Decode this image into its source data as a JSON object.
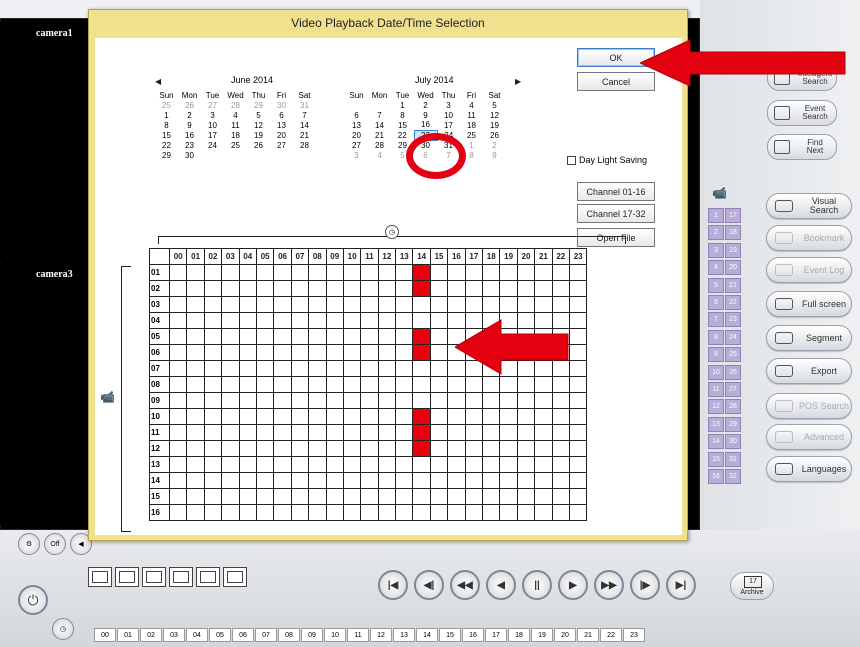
{
  "cameras": {
    "cam1": "camera1",
    "cam3": "camera3"
  },
  "dialog": {
    "title": "Video Playback Date/Time Selection",
    "ok": "OK",
    "cancel": "Cancel",
    "daylight": "Day Light Saving",
    "ch1": "Channel 01-16",
    "ch2": "Channel 17-32",
    "open": "Open File",
    "cal1": {
      "title": "June 2014",
      "days": [
        "Sun",
        "Mon",
        "Tue",
        "Wed",
        "Thu",
        "Fri",
        "Sat"
      ],
      "weeks": [
        [
          "25",
          "26",
          "27",
          "28",
          "29",
          "30",
          "31"
        ],
        [
          "1",
          "2",
          "3",
          "4",
          "5",
          "6",
          "7"
        ],
        [
          "8",
          "9",
          "10",
          "11",
          "12",
          "13",
          "14"
        ],
        [
          "15",
          "16",
          "17",
          "18",
          "19",
          "20",
          "21"
        ],
        [
          "22",
          "23",
          "24",
          "25",
          "26",
          "27",
          "28"
        ],
        [
          "29",
          "30",
          "",
          "",
          "",
          "",
          ""
        ]
      ]
    },
    "cal2": {
      "title": "July 2014",
      "days": [
        "Sun",
        "Mon",
        "Tue",
        "Wed",
        "Thu",
        "Fri",
        "Sat"
      ],
      "weeks": [
        [
          "",
          "",
          "1",
          "2",
          "3",
          "4",
          "5"
        ],
        [
          "6",
          "7",
          "8",
          "9",
          "10",
          "11",
          "12"
        ],
        [
          "13",
          "14",
          "15",
          "16",
          "17",
          "18",
          "19"
        ],
        [
          "20",
          "21",
          "22",
          "23",
          "24",
          "25",
          "26"
        ],
        [
          "27",
          "28",
          "29",
          "30",
          "31",
          "1",
          "2"
        ],
        [
          "3",
          "4",
          "5",
          "6",
          "7",
          "8",
          "9"
        ]
      ],
      "selected": "23"
    }
  },
  "grid": {
    "hours": [
      "00",
      "01",
      "02",
      "03",
      "04",
      "05",
      "06",
      "07",
      "08",
      "09",
      "10",
      "11",
      "12",
      "13",
      "14",
      "15",
      "16",
      "17",
      "18",
      "19",
      "20",
      "21",
      "22",
      "23"
    ],
    "channels": [
      "01",
      "02",
      "03",
      "04",
      "05",
      "06",
      "07",
      "08",
      "09",
      "10",
      "11",
      "12",
      "13",
      "14",
      "15",
      "16"
    ],
    "recorded": {
      "14": [
        "01",
        "02",
        "05",
        "06",
        "10",
        "11",
        "12"
      ]
    }
  },
  "right_search": [
    {
      "l1": "Intelligent",
      "l2": "Search"
    },
    {
      "l1": "Event",
      "l2": "Search"
    },
    {
      "l1": "Find",
      "l2": "Next"
    }
  ],
  "right_buttons": [
    {
      "label": "Visual Search",
      "enabled": true
    },
    {
      "label": "Bookmark",
      "enabled": false
    },
    {
      "label": "Event Log",
      "enabled": false
    },
    {
      "label": "Full screen",
      "enabled": true
    },
    {
      "label": "Segment",
      "enabled": true
    },
    {
      "label": "Export",
      "enabled": true
    },
    {
      "label": "POS Search",
      "enabled": false
    },
    {
      "label": "Advanced",
      "enabled": false
    },
    {
      "label": "Languages",
      "enabled": true
    }
  ],
  "channel_numbers": [
    "1",
    "17",
    "2",
    "18",
    "3",
    "19",
    "4",
    "20",
    "5",
    "21",
    "6",
    "22",
    "7",
    "23",
    "8",
    "24",
    "9",
    "25",
    "10",
    "26",
    "11",
    "27",
    "12",
    "28",
    "13",
    "29",
    "14",
    "30",
    "15",
    "31",
    "16",
    "32"
  ],
  "archive": {
    "day": "17",
    "label": "Archive"
  },
  "small_icons": {
    "off": "Off"
  },
  "timeline": [
    "00",
    "01",
    "02",
    "03",
    "04",
    "05",
    "06",
    "07",
    "08",
    "09",
    "10",
    "11",
    "12",
    "13",
    "14",
    "15",
    "16",
    "17",
    "18",
    "19",
    "20",
    "21",
    "22",
    "23"
  ],
  "colors": {
    "record": "#e8000b",
    "dialog": "#f0e18e",
    "channel": "#b8acd8",
    "annotation": "#e30010"
  }
}
